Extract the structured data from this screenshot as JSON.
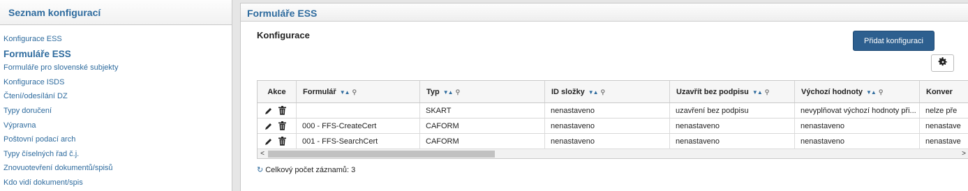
{
  "sidebar": {
    "title": "Seznam konfigurací",
    "items": [
      {
        "label": "Konfigurace ESS"
      },
      {
        "label": "Formuláře ESS"
      },
      {
        "label": "Formuláře pro slovenské subjekty"
      },
      {
        "label": "Konfigurace ISDS"
      },
      {
        "label": "Čtení/odesílání DZ"
      },
      {
        "label": "Typy doručení"
      },
      {
        "label": "Výpravna"
      },
      {
        "label": "Poštovní podací arch"
      },
      {
        "label": "Typy číselných řad č.j."
      },
      {
        "label": "Znovuotevření dokumentů/spisů"
      },
      {
        "label": "Kdo vidí dokument/spis"
      }
    ],
    "active_index": 1
  },
  "main": {
    "title": "Formuláře ESS",
    "section_title": "Konfigurace",
    "add_button": "Přidat konfiguraci",
    "columns": [
      "Akce",
      "Formulář",
      "Typ",
      "ID složky",
      "Uzavřít bez podpisu",
      "Výchozí hodnoty",
      "Konver"
    ],
    "rows": [
      [
        "",
        "SKART",
        "nenastaveno",
        "uzavření bez podpisu",
        "nevyplňovat výchozí hodnoty při...",
        "nelze pře"
      ],
      [
        "000 - FFS-CreateCert",
        "CAFORM",
        "nenastaveno",
        "nenastaveno",
        "nenastaveno",
        "nenastave"
      ],
      [
        "001 - FFS-SearchCert",
        "CAFORM",
        "nenastaveno",
        "nenastaveno",
        "nenastaveno",
        "nenastave"
      ]
    ],
    "footer": "Celkový počet záznamů: 3"
  },
  "icons": {
    "edit": "pencil-icon",
    "delete": "trash-icon",
    "settings": "gear-icon",
    "refresh": "refresh-icon",
    "sort": "sort-arrows-icon",
    "filter": "filter-icon"
  },
  "colors": {
    "accent": "#2e6b9e",
    "button": "#2d5f8f"
  }
}
